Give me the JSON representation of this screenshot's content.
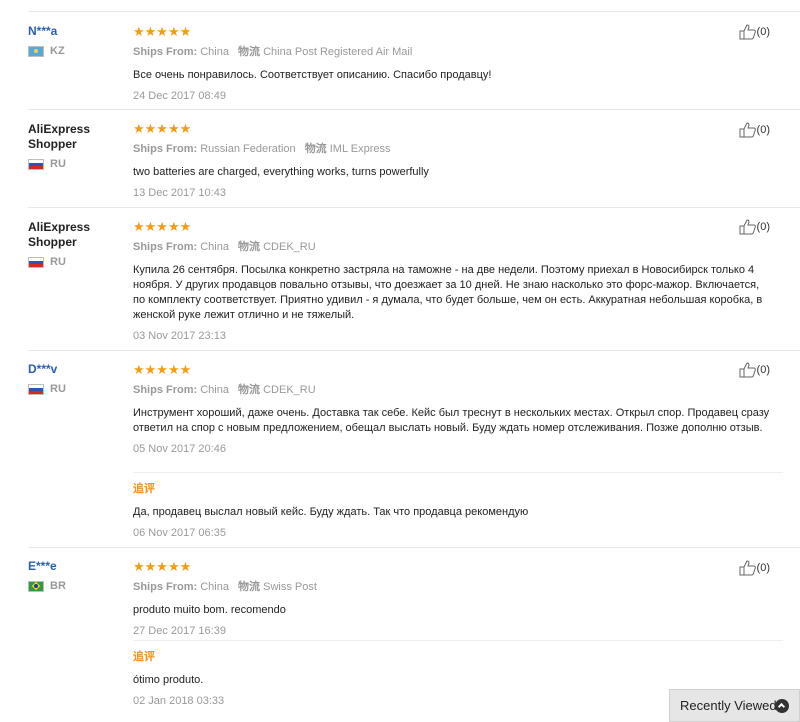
{
  "reviews": [
    {
      "buyer": "N***a",
      "country": "KZ",
      "stars": "★★★★★",
      "ships_from_label": "Ships From:",
      "ships_from": "China",
      "carrier_label": "物流",
      "carrier": "China Post Registered Air Mail",
      "text": "Все очень понравилось. Соответствует описанию. Спасибо продавцу!",
      "date": "24 Dec 2017 08:49",
      "likes": "(0)"
    },
    {
      "buyer": "AliExpress Shopper",
      "country": "RU",
      "stars": "★★★★★",
      "ships_from_label": "Ships From:",
      "ships_from": "Russian Federation",
      "carrier_label": "物流",
      "carrier": "IML Express",
      "text": "two batteries are charged, everything works, turns powerfully",
      "date": "13 Dec 2017 10:43",
      "likes": "(0)"
    },
    {
      "buyer": "AliExpress Shopper",
      "country": "RU",
      "stars": "★★★★★",
      "ships_from_label": "Ships From:",
      "ships_from": "China",
      "carrier_label": "物流",
      "carrier": "CDEK_RU",
      "text": "Купила 26 сентября. Посылка конкретно застряла на таможне - на две недели. Поэтому приехал в Новосибирск только 4 ноября. У других продавцов повально отзывы, что доезжает за 10 дней. Не знаю насколько это форс-мажор. Включается, по комплекту соответствует. Приятно удивил - я думала, что будет больше, чем он есть. Аккуратная небольшая коробка, в женской руке лежит отлично и не тяжелый.",
      "date": "03 Nov 2017 23:13",
      "likes": "(0)"
    },
    {
      "buyer": "D***v",
      "country": "RU",
      "stars": "★★★★★",
      "ships_from_label": "Ships From:",
      "ships_from": "China",
      "carrier_label": "物流",
      "carrier": "CDEK_RU",
      "text": "Инструмент хороший, даже очень. Доставка так себе. Кейс был треснут в нескольких местах. Открыл спор. Продавец сразу ответил на спор с новым предложением, обещал выслать новый. Буду ждать номер отслеживания. Позже дополню отзыв.",
      "date": "05 Nov 2017 20:46",
      "likes": "(0)",
      "followup_label": "追评",
      "followup_text": "Да, продавец выслал новый кейс. Буду ждать. Так что продавца рекомендую",
      "followup_date": "06 Nov 2017 06:35"
    },
    {
      "buyer": "E***e",
      "country": "BR",
      "stars": "★★★★★",
      "ships_from_label": "Ships From:",
      "ships_from": "China",
      "carrier_label": "物流",
      "carrier": "Swiss Post",
      "text": "produto muito bom. recomendo",
      "date": "27 Dec 2017 16:39",
      "likes": "(0)",
      "followup_label": "追评",
      "followup_text": "ótimo produto.",
      "followup_date": "02 Jan 2018 03:33"
    }
  ],
  "recently_viewed": {
    "label": "Recently Viewed"
  },
  "colors": {
    "star": "#f39c12",
    "link": "#2a5fb0",
    "muted": "#999999",
    "followup_label": "#f38f1c"
  },
  "icons": [
    "thumbs-up-icon",
    "chevron-up-icon",
    "flag-kz",
    "flag-ru",
    "flag-br"
  ]
}
